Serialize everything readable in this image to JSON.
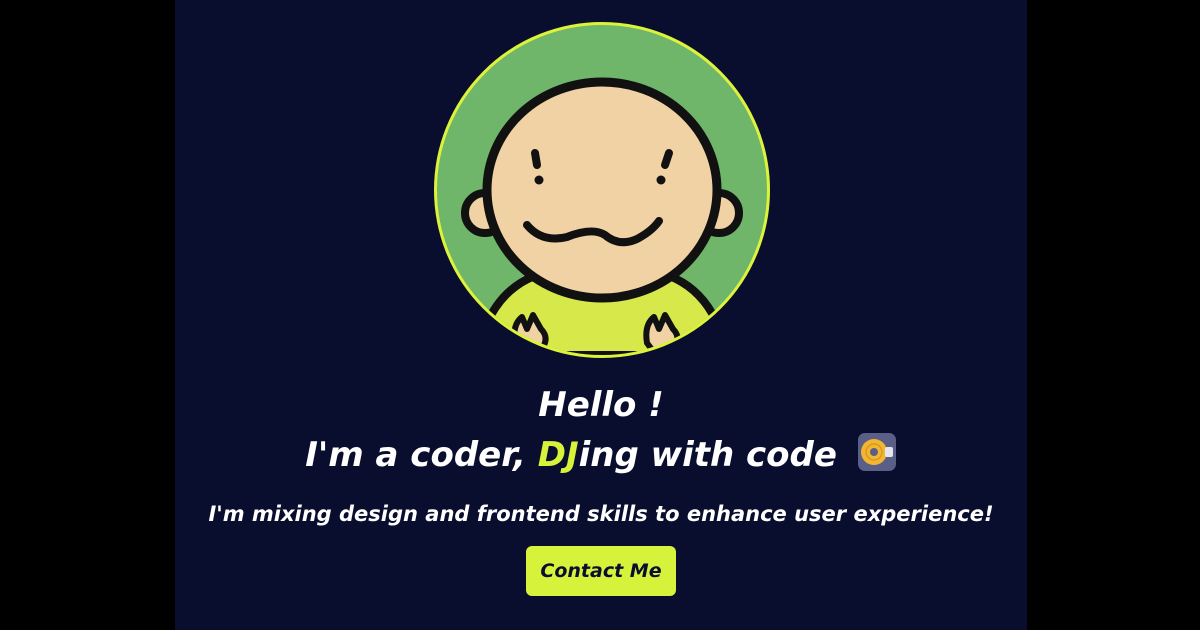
{
  "hero": {
    "greeting": "Hello !",
    "tagline_prefix": "I'm a coder, ",
    "tagline_accent": "DJ",
    "tagline_suffix": "ing with code",
    "tagline_icon": "dj-disc-icon",
    "subtitle": "I'm mixing design and frontend skills to enhance user experience!",
    "cta_label": "Contact Me"
  },
  "avatar": {
    "icon": "cartoon-avatar"
  },
  "colors": {
    "page_background": "#000000",
    "panel_background": "#0a0e2e",
    "accent": "#d7f23a",
    "avatar_background": "#6fb56a",
    "text": "#ffffff"
  }
}
